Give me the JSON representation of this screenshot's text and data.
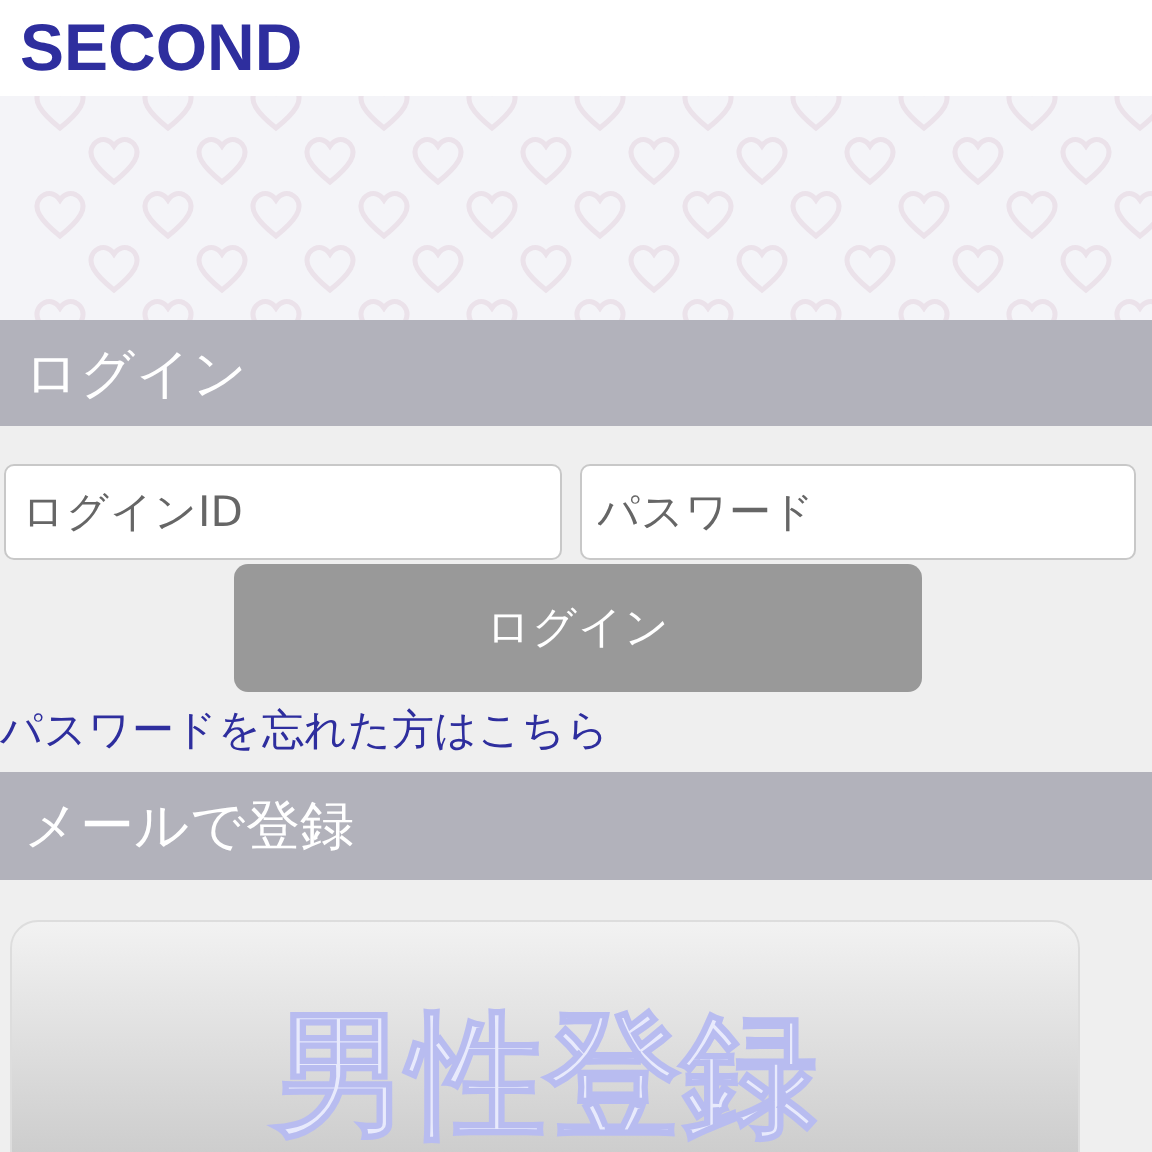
{
  "site": {
    "title": "SECOND"
  },
  "login_section": {
    "heading": "ログイン",
    "id_field": {
      "placeholder": "ログインID"
    },
    "password_field": {
      "placeholder": "パスワード"
    },
    "button": "ログイン",
    "forgot_link": "パスワードを忘れた方はこちら"
  },
  "register_section": {
    "heading": "メールで登録",
    "button": "男性登録"
  }
}
